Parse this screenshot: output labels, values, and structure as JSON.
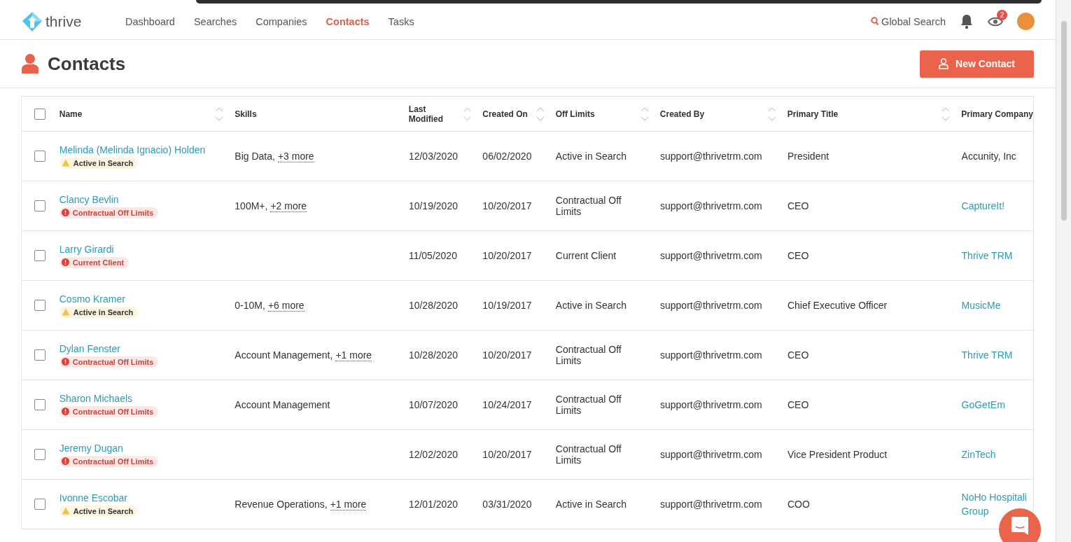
{
  "nav": {
    "logo": "thrive",
    "items": [
      {
        "label": "Dashboard",
        "selected": false
      },
      {
        "label": "Searches",
        "selected": false
      },
      {
        "label": "Companies",
        "selected": false
      },
      {
        "label": "Contacts",
        "selected": true
      },
      {
        "label": "Tasks",
        "selected": false
      }
    ],
    "global_search": "Global Search",
    "watch_badge": "2"
  },
  "page": {
    "title": "Contacts",
    "new_button": "New Contact"
  },
  "table": {
    "all_checked": false,
    "columns": [
      {
        "label": "Name",
        "sortable": true
      },
      {
        "label": "Skills",
        "sortable": false
      },
      {
        "label": "Last Modified",
        "sortable": true
      },
      {
        "label": "Created On",
        "sortable": true
      },
      {
        "label": "Off Limits",
        "sortable": true
      },
      {
        "label": "Created By",
        "sortable": true
      },
      {
        "label": "Primary Title",
        "sortable": true
      },
      {
        "label": "Primary Company",
        "sortable": false
      }
    ],
    "rows": [
      {
        "checked": false,
        "name": "Melinda (Melinda Ignacio) Holden",
        "status": {
          "kind": "warning",
          "label": "Active in Search"
        },
        "skills": "Big Data,",
        "skills_more": "+3 more",
        "last_modified": "12/03/2020",
        "created_on": "06/02/2020",
        "off_limits": "Active in Search",
        "created_by": "support@thrivetrm.com",
        "title": "President",
        "company": "Accunity, Inc",
        "company_linked": false
      },
      {
        "checked": false,
        "name": "Clancy Bevlin",
        "status": {
          "kind": "error",
          "label": "Contractual Off Limits"
        },
        "skills": "100M+,",
        "skills_more": "+2 more",
        "last_modified": "10/19/2020",
        "created_on": "10/20/2017",
        "off_limits": "Contractual Off Limits",
        "created_by": "support@thrivetrm.com",
        "title": "CEO",
        "company": "CaptureIt!",
        "company_linked": true
      },
      {
        "checked": false,
        "name": "Larry Girardi",
        "status": {
          "kind": "error",
          "label": "Current Client"
        },
        "last_modified": "11/05/2020",
        "created_on": "10/20/2017",
        "off_limits": "Current Client",
        "created_by": "support@thrivetrm.com",
        "title": "CEO",
        "company": "Thrive TRM",
        "company_linked": true
      },
      {
        "checked": false,
        "name": "Cosmo Kramer",
        "status": {
          "kind": "warning",
          "label": "Active in Search"
        },
        "skills": "0-10M,",
        "skills_more": "+6 more",
        "last_modified": "10/28/2020",
        "created_on": "10/19/2017",
        "off_limits": "Active in Search",
        "created_by": "support@thrivetrm.com",
        "title": "Chief Executive Officer",
        "company": "MusicMe",
        "company_linked": true
      },
      {
        "checked": false,
        "name": "Dylan Fenster",
        "status": {
          "kind": "error",
          "label": "Contractual Off Limits"
        },
        "skills": "Account Management,",
        "skills_more": "+1 more",
        "last_modified": "10/28/2020",
        "created_on": "10/20/2017",
        "off_limits": "Contractual Off Limits",
        "created_by": "support@thrivetrm.com",
        "title": "CEO",
        "company": "Thrive TRM",
        "company_linked": true
      },
      {
        "checked": false,
        "name": "Sharon Michaels",
        "status": {
          "kind": "error",
          "label": "Contractual Off Limits"
        },
        "skills": "Account Management",
        "last_modified": "10/07/2020",
        "created_on": "10/24/2017",
        "off_limits": "Contractual Off Limits",
        "created_by": "support@thrivetrm.com",
        "title": "CEO",
        "company": "GoGetEm",
        "company_linked": true
      },
      {
        "checked": false,
        "name": "Jeremy Dugan",
        "status": {
          "kind": "error",
          "label": "Contractual Off Limits"
        },
        "last_modified": "12/02/2020",
        "created_on": "10/20/2017",
        "off_limits": "Contractual Off Limits",
        "created_by": "support@thrivetrm.com",
        "title": "Vice President Product",
        "company": "ZinTech",
        "company_linked": true
      },
      {
        "checked": false,
        "name": "Ivonne Escobar",
        "status": {
          "kind": "warning",
          "label": "Active in Search"
        },
        "skills": "Revenue Operations,",
        "skills_more": "+1 more",
        "last_modified": "12/01/2020",
        "created_on": "03/31/2020",
        "off_limits": "Active in Search",
        "created_by": "support@thrivetrm.com",
        "title": "COO",
        "company": "NoHo Hospitali Group",
        "company_linked": true
      }
    ]
  }
}
